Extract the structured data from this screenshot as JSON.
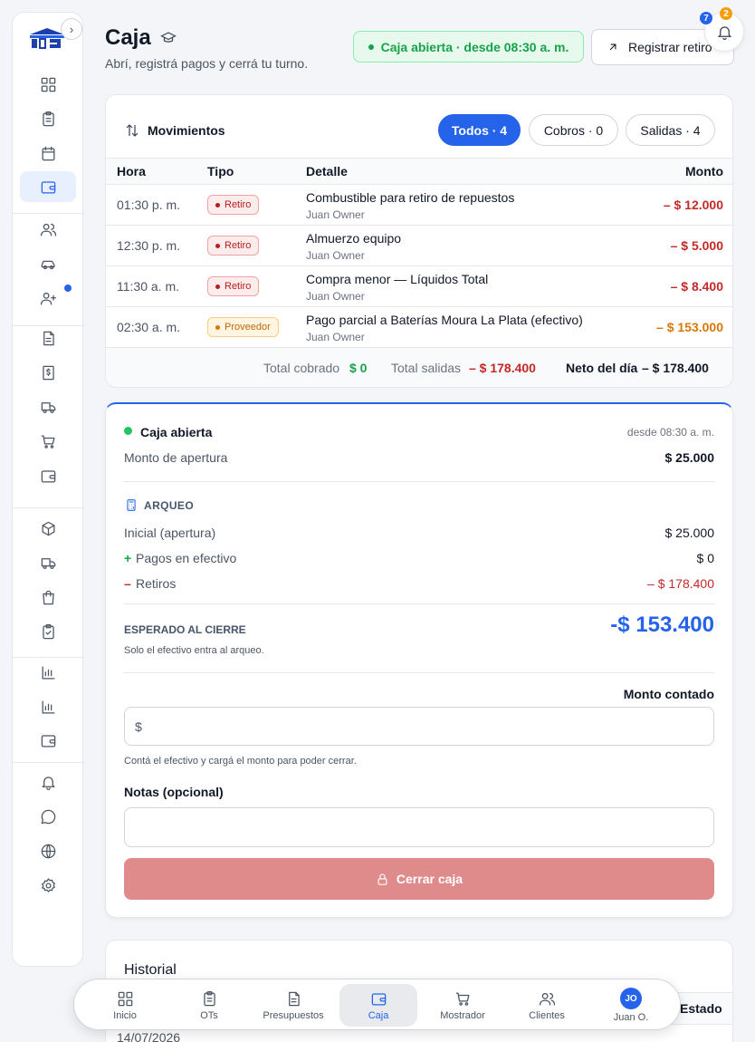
{
  "header": {
    "title": "Caja",
    "subtitle": "Abrí, registrá pagos y cerrá tu turno.",
    "status": "Caja abierta · desde 08:30 a. m.",
    "withdraw_label": "Registrar retiro",
    "notif_badge_blue": "7",
    "notif_badge_orange": "2"
  },
  "sidebar": {
    "items": [
      "dashboard-icon",
      "clipboard-icon",
      "calendar-icon",
      "wallet-icon",
      "users-icon",
      "car-icon",
      "user-plus-icon",
      "document-icon",
      "dollar-icon",
      "truck-icon",
      "cart-icon",
      "wallet-icon",
      "package-icon",
      "truck-icon",
      "bag-icon",
      "clipboard-check-icon",
      "chart-icon",
      "chart-icon",
      "wallet-icon",
      "bell-icon",
      "chat-icon",
      "globe-icon",
      "gear-icon"
    ],
    "active": "wallet-icon"
  },
  "movements": {
    "title": "Movimientos",
    "filters": [
      "Todos · 4",
      "Cobros · 0",
      "Salidas · 4"
    ],
    "columns": [
      "Hora",
      "Tipo",
      "Detalle",
      "Monto"
    ],
    "rows": [
      {
        "hora": "01:30 p. m.",
        "tipo": "Retiro",
        "detalle": "Combustible para retiro de repuestos",
        "usuario": "Juan Owner",
        "monto": "– $ 12.000"
      },
      {
        "hora": "12:30 p. m.",
        "tipo": "Retiro",
        "detalle": "Almuerzo equipo",
        "usuario": "Juan Owner",
        "monto": "– $ 5.000"
      },
      {
        "hora": "11:30 a. m.",
        "tipo": "Retiro",
        "detalle": "Compra menor — Líquidos Total",
        "usuario": "Juan Owner",
        "monto": "– $ 8.400"
      },
      {
        "hora": "02:30 a. m.",
        "tipo": "Proveedor",
        "detalle": "Pago parcial a Baterías Moura La Plata (efectivo)",
        "usuario": "Juan Owner",
        "monto": "– $ 153.000"
      }
    ],
    "totals": {
      "cobrado_label": "Total cobrado",
      "cobrado_value": "$ 0",
      "salidas_label": "Total salidas",
      "salidas_value": "– $ 178.400",
      "neto_label": "Neto del día",
      "neto_value": "– $ 178.400"
    }
  },
  "register": {
    "status": "Caja abierta",
    "since": "desde 08:30 a. m.",
    "apertura_label": "Monto de apertura",
    "apertura_value": "$ 25.000",
    "arqueo_title": "ARQUEO",
    "inicial_label": "Inicial (apertura)",
    "inicial_value": "$ 25.000",
    "pagos_sign": "+",
    "pagos_label": "Pagos en efectivo",
    "pagos_value": "$ 0",
    "retiros_sign": "–",
    "retiros_label": "Retiros",
    "retiros_value": "– $ 178.400",
    "esperado_label": "ESPERADO AL CIERRE",
    "esperado_value": "-$ 153.400",
    "esperado_note": "Solo el efectivo entra al arqueo.",
    "contado_label": "Monto contado",
    "currency": "$",
    "contado_value": "",
    "contado_help": "Contá el efectivo y cargá el monto para poder cerrar.",
    "notas_label": "Notas (opcional)",
    "notas_value": "",
    "close_label": "Cerrar caja"
  },
  "history": {
    "title": "Historial",
    "col_estado": "Estado",
    "first_date": "14/07/2026"
  },
  "bottom_nav": {
    "items": [
      {
        "label": "Inicio",
        "icon": "dashboard-icon"
      },
      {
        "label": "OTs",
        "icon": "clipboard-icon"
      },
      {
        "label": "Presupuestos",
        "icon": "document-icon"
      },
      {
        "label": "Caja",
        "icon": "wallet-icon"
      },
      {
        "label": "Mostrador",
        "icon": "cart-icon"
      },
      {
        "label": "Clientes",
        "icon": "users-icon"
      },
      {
        "label": "Juan O.",
        "icon": "avatar"
      }
    ],
    "active": "Caja",
    "avatar_initials": "JO"
  },
  "colors": {
    "primary": "#2563eb",
    "success": "#16a34a",
    "danger": "#c62828",
    "warning": "#d97706",
    "close_button": "#e08b8b"
  }
}
